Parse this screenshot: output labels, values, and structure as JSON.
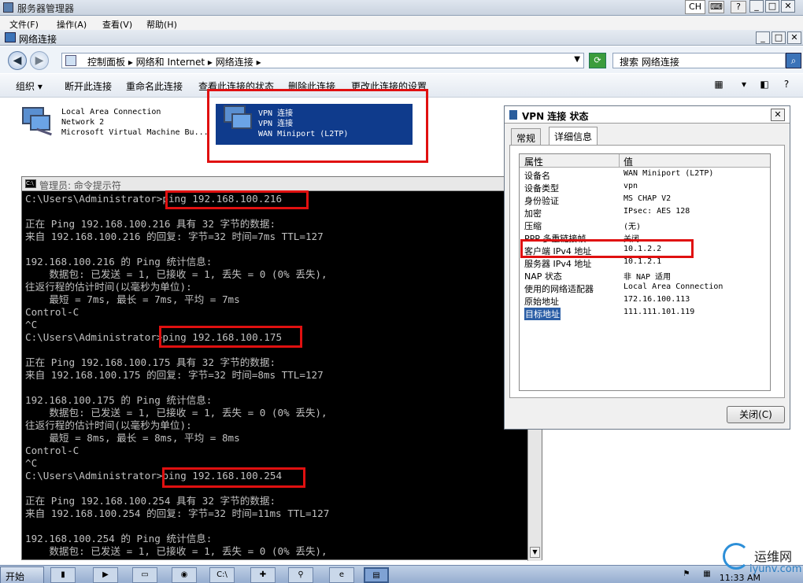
{
  "server_manager": {
    "title": "服务器管理器",
    "menu": [
      "文件(F)",
      "操作(A)",
      "查看(V)",
      "帮助(H)"
    ],
    "lang": "CH"
  },
  "netwin": {
    "title": "网络连接",
    "breadcrumb": "控制面板 ▸ 网络和 Internet ▸ 网络连接 ▸",
    "search_placeholder": "搜索 网络连接",
    "commands": [
      "组织 ▾",
      "断开此连接",
      "重命名此连接",
      "查看此连接的状态",
      "删除此连接",
      "更改此连接的设置"
    ],
    "connections": [
      {
        "name": "Local Area Connection",
        "status": "Network  2",
        "device": "Microsoft Virtual Machine Bu..."
      },
      {
        "name": "VPN 连接",
        "status": "VPN 连接",
        "device": "WAN Miniport (L2TP)"
      }
    ]
  },
  "cmd": {
    "title": "管理员: 命令提示符",
    "lines": [
      "C:\\Users\\Administrator>ping 192.168.100.216",
      "",
      "正在 Ping 192.168.100.216 具有 32 字节的数据:",
      "来自 192.168.100.216 的回复: 字节=32 时间=7ms TTL=127",
      "",
      "192.168.100.216 的 Ping 统计信息:",
      "    数据包: 已发送 = 1, 已接收 = 1, 丢失 = 0 (0% 丢失),",
      "往返行程的估计时间(以毫秒为单位):",
      "    最短 = 7ms, 最长 = 7ms, 平均 = 7ms",
      "Control-C",
      "^C",
      "C:\\Users\\Administrator>ping 192.168.100.175",
      "",
      "正在 Ping 192.168.100.175 具有 32 字节的数据:",
      "来自 192.168.100.175 的回复: 字节=32 时间=8ms TTL=127",
      "",
      "192.168.100.175 的 Ping 统计信息:",
      "    数据包: 已发送 = 1, 已接收 = 1, 丢失 = 0 (0% 丢失),",
      "往返行程的估计时间(以毫秒为单位):",
      "    最短 = 8ms, 最长 = 8ms, 平均 = 8ms",
      "Control-C",
      "^C",
      "C:\\Users\\Administrator>ping 192.168.100.254",
      "",
      "正在 Ping 192.168.100.254 具有 32 字节的数据:",
      "来自 192.168.100.254 的回复: 字节=32 时间=11ms TTL=127",
      "",
      "192.168.100.254 的 Ping 统计信息:",
      "    数据包: 已发送 = 1, 已接收 = 1, 丢失 = 0 (0% 丢失),"
    ]
  },
  "status": {
    "title": "VPN 连接 状态",
    "tabs": [
      "常规",
      "详细信息"
    ],
    "col_property": "属性",
    "col_value": "值",
    "rows": [
      {
        "k": "设备名",
        "v": "WAN Miniport (L2TP)"
      },
      {
        "k": "设备类型",
        "v": "vpn"
      },
      {
        "k": "身份验证",
        "v": "MS CHAP V2"
      },
      {
        "k": "加密",
        "v": "IPsec: AES 128"
      },
      {
        "k": "压缩",
        "v": "(无)"
      },
      {
        "k": "PPP 多重链接帧",
        "v": "关闭"
      },
      {
        "k": "客户端 IPv4 地址",
        "v": "10.1.2.2"
      },
      {
        "k": "服务器 IPv4 地址",
        "v": "10.1.2.1"
      },
      {
        "k": "NAP 状态",
        "v": "非 NAP 适用"
      },
      {
        "k": "使用的网络适配器",
        "v": "Local Area Connection"
      },
      {
        "k": "原始地址",
        "v": "172.16.100.113"
      },
      {
        "k": "目标地址",
        "v": "111.111.101.119"
      }
    ],
    "close_label": "关闭(C)"
  },
  "taskbar": {
    "start": "开始",
    "clock": "11:33 AM"
  },
  "watermark": {
    "line1": "运维网",
    "line2": "iyunv.com"
  }
}
